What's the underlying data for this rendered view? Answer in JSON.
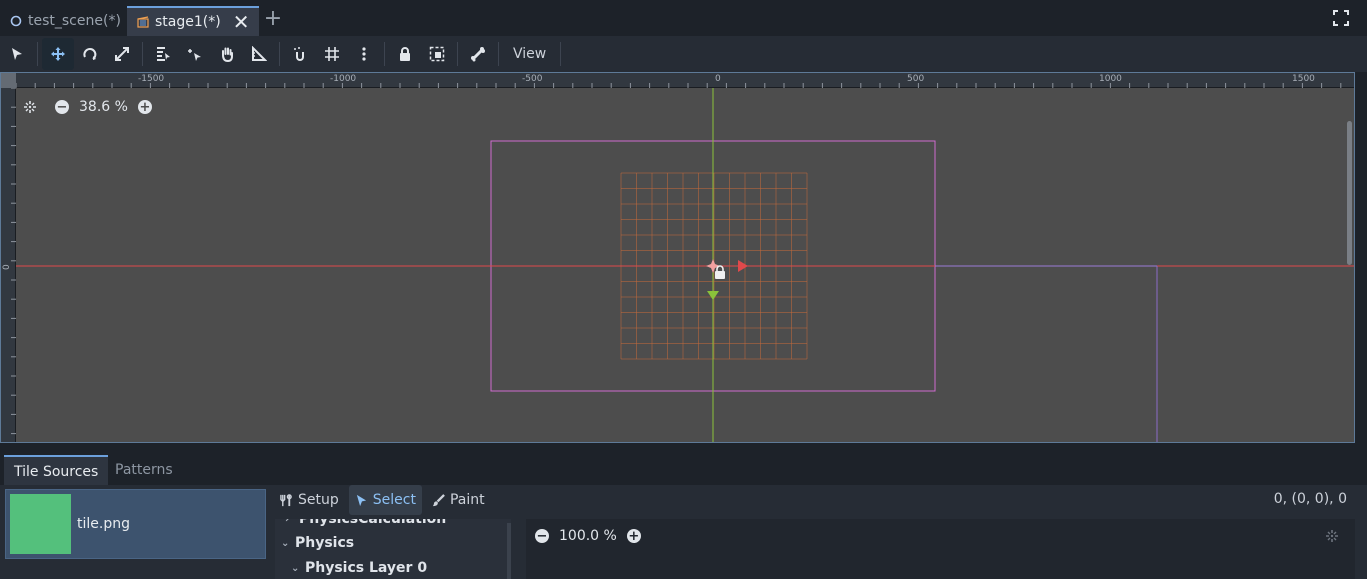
{
  "tabs": [
    {
      "label": "test_scene(*)",
      "active": false
    },
    {
      "label": "stage1(*)",
      "active": true
    }
  ],
  "toolbar": {
    "view_label": "View",
    "icons": [
      "select-arrow-icon",
      "move-icon",
      "rotate-icon",
      "scale-icon",
      "list-select-icon",
      "pivot-icon",
      "pan-hand-icon",
      "ruler-icon",
      "smart-snap-icon",
      "grid-snap-icon",
      "more-vertical-icon",
      "lock-icon",
      "group-icon",
      "bone-icon"
    ]
  },
  "viewport": {
    "zoom_label": "38.6 %",
    "ruler_labels": [
      "-1500",
      "-1000",
      "-500",
      "0",
      "500",
      "1000",
      "1500"
    ],
    "ruler_left_label": "0",
    "colors": {
      "frame": "#d06ad0",
      "x_axis": "#e0494b",
      "y_axis": "#8ac23a",
      "grid": "#c06a3c"
    }
  },
  "bottom_panel": {
    "tabs": [
      {
        "label": "Tile Sources",
        "active": true
      },
      {
        "label": "Patterns",
        "active": false
      }
    ],
    "source": {
      "name": "tile.png",
      "color": "#54c07c"
    },
    "modes": [
      {
        "label": "Setup",
        "icon": "tools-icon",
        "active": false
      },
      {
        "label": "Select",
        "icon": "cursor-icon",
        "active": true
      },
      {
        "label": "Paint",
        "icon": "brush-icon",
        "active": false
      }
    ],
    "coords": "0, (0, 0), 0",
    "inspector": [
      {
        "label": "PhysicsCalculation",
        "expanded": false
      },
      {
        "label": "Physics",
        "expanded": true
      },
      {
        "label": "Physics Layer 0",
        "expanded": true
      }
    ],
    "atlas_zoom": "100.0 %"
  }
}
